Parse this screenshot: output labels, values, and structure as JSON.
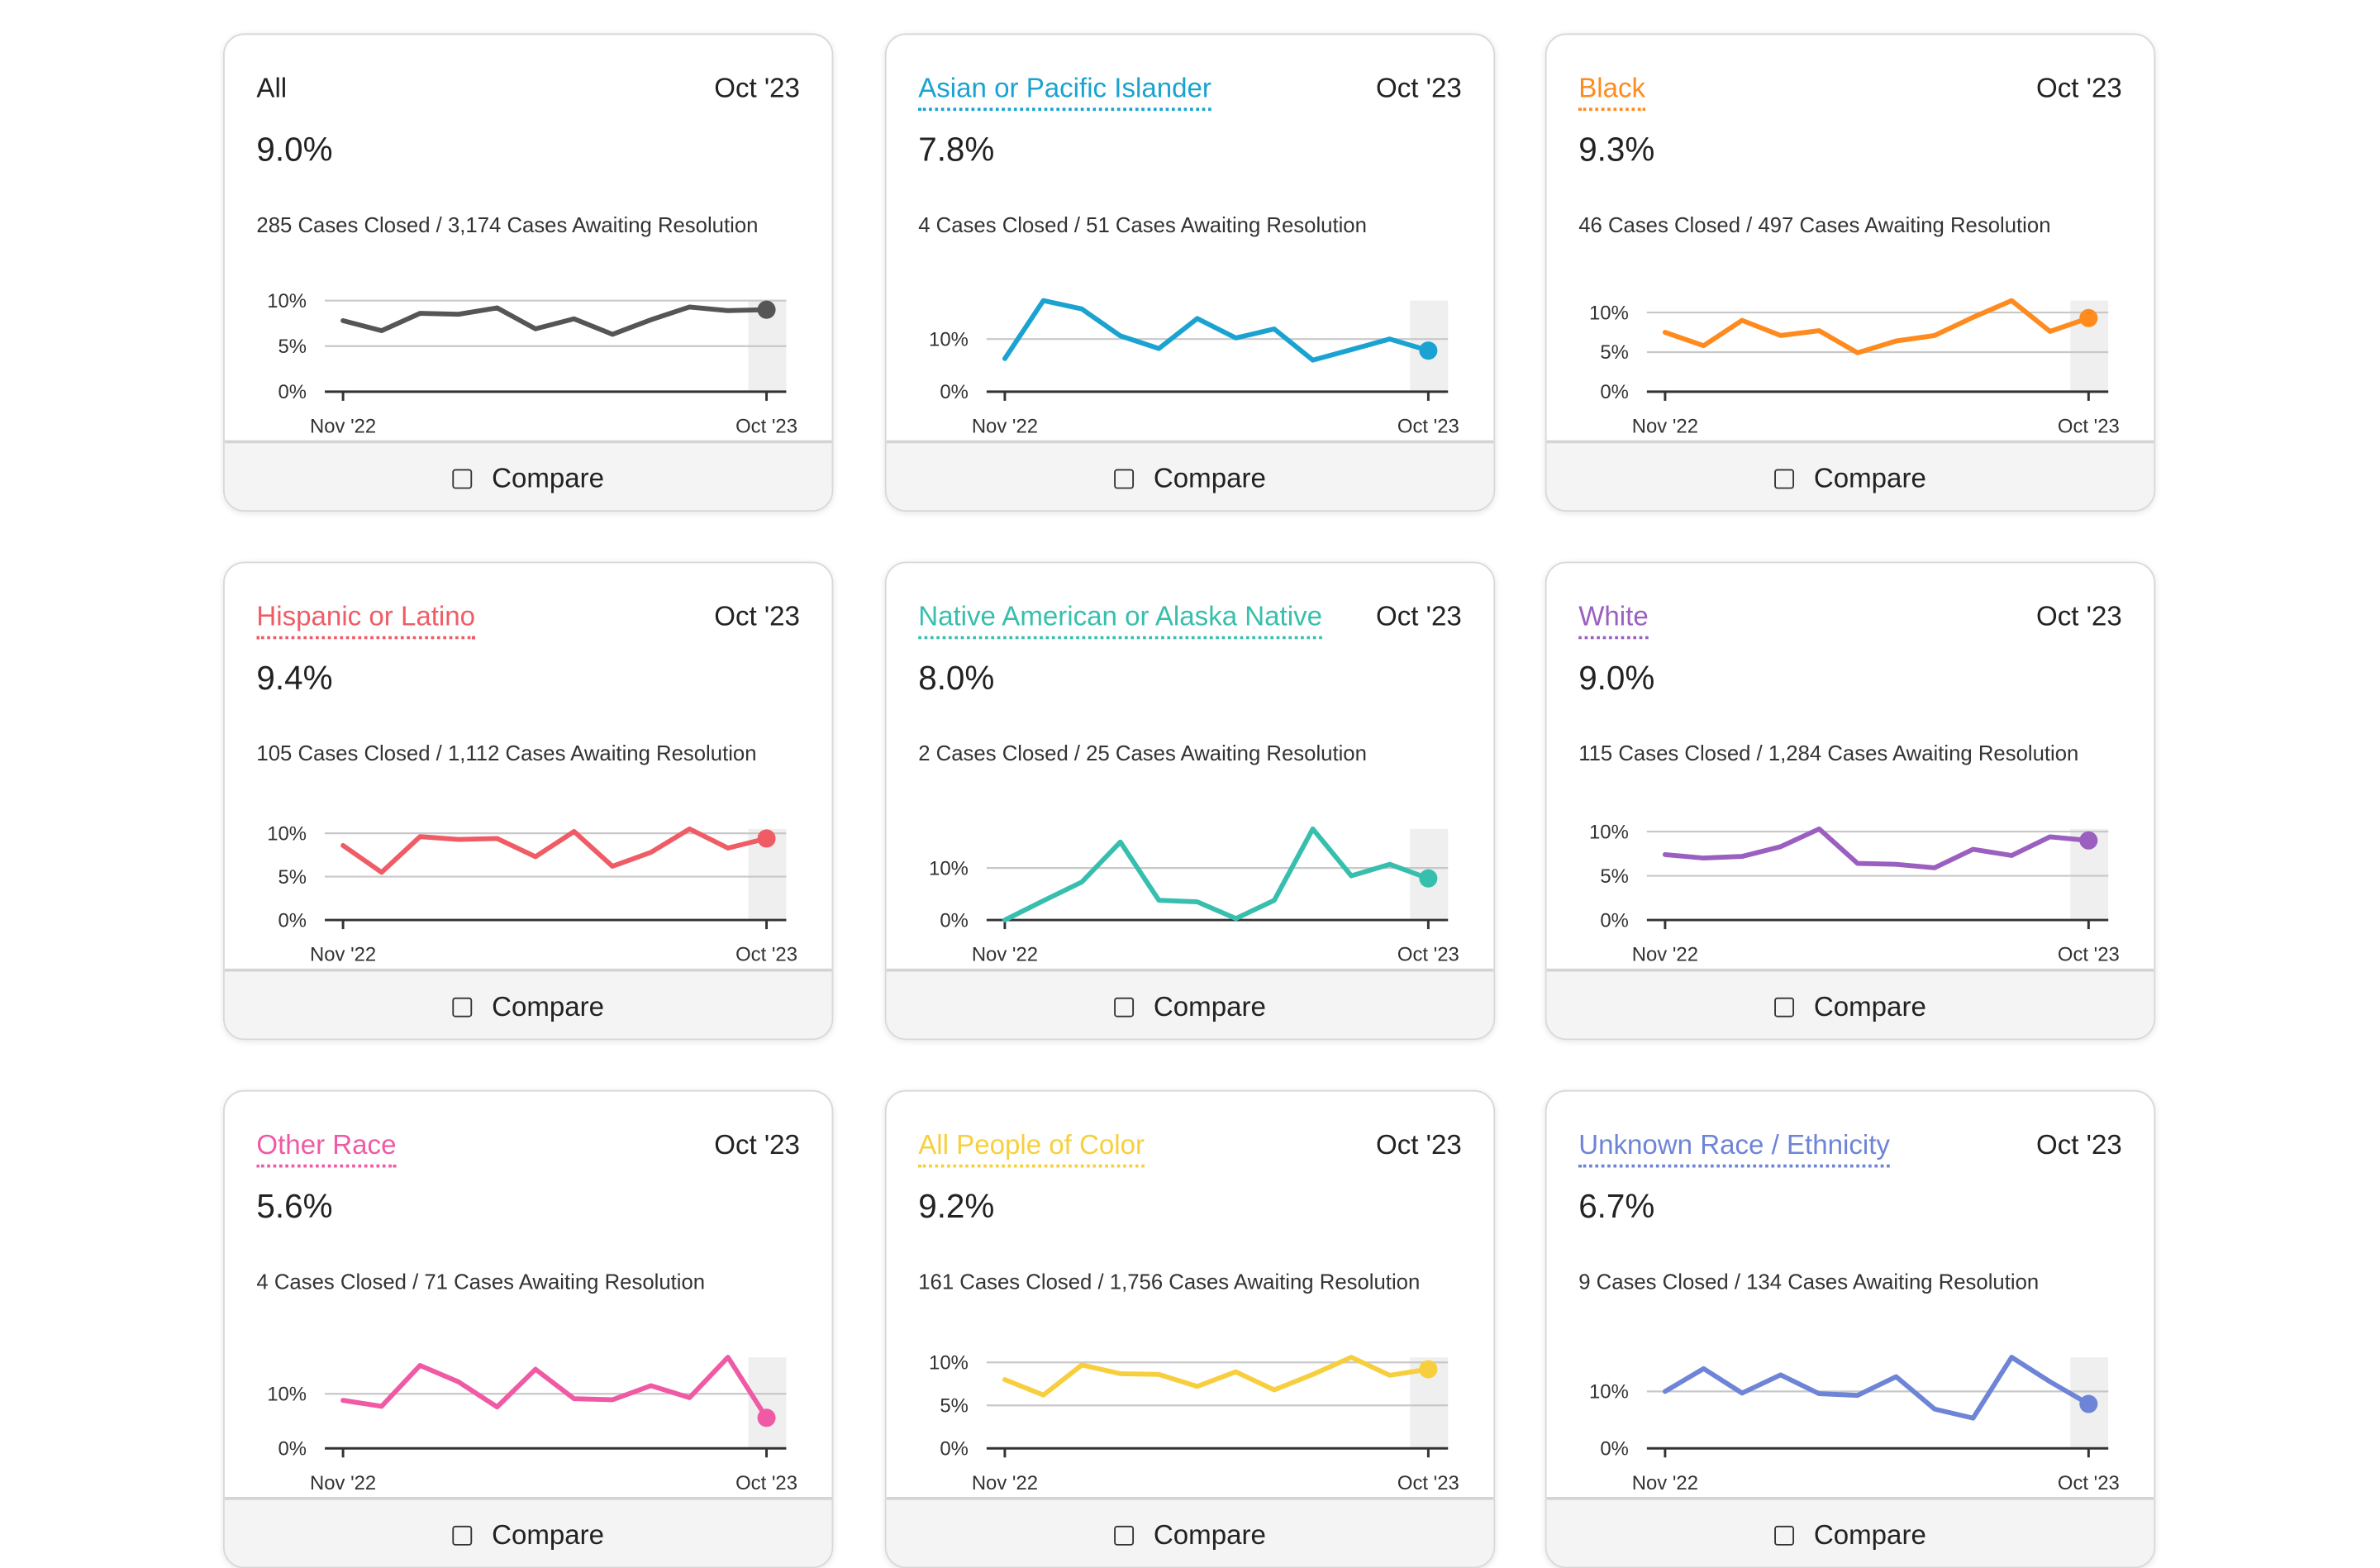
{
  "compare_label": "Compare",
  "axis": {
    "x_start": "Nov '22",
    "x_end": "Oct '23"
  },
  "chart_data": [
    {
      "type": "line",
      "title": "All",
      "date": "Oct '23",
      "value": "9.0%",
      "detail": "285 Cases Closed / 3,174 Cases Awaiting Resolution",
      "color": "#555555",
      "ylim": [
        0,
        10
      ],
      "yticks": [
        "10%",
        "5%",
        "0%"
      ],
      "values": [
        7.8,
        6.7,
        8.6,
        8.5,
        9.2,
        6.9,
        8.0,
        6.3,
        7.9,
        9.3,
        8.9,
        9.0
      ]
    },
    {
      "type": "line",
      "title": "Asian or Pacific Islander",
      "date": "Oct '23",
      "value": "7.8%",
      "detail": "4 Cases Closed / 51 Cases Awaiting Resolution",
      "color": "#1aa3d1",
      "ylim": [
        0,
        10
      ],
      "yticks": [
        "10%",
        "0%"
      ],
      "values": [
        6.3,
        17.3,
        15.7,
        10.6,
        8.2,
        13.9,
        10.2,
        11.9,
        6.0,
        8.0,
        10.0,
        7.8
      ]
    },
    {
      "type": "line",
      "title": "Black",
      "date": "Oct '23",
      "value": "9.3%",
      "detail": "46 Cases Closed / 497 Cases Awaiting Resolution",
      "color": "#ff8a1e",
      "ylim": [
        0,
        10
      ],
      "yticks": [
        "10%",
        "5%",
        "0%"
      ],
      "values": [
        7.5,
        5.8,
        9.0,
        7.1,
        7.7,
        4.9,
        6.4,
        7.1,
        9.4,
        11.5,
        7.6,
        9.3
      ]
    },
    {
      "type": "line",
      "title": "Hispanic or Latino",
      "date": "Oct '23",
      "value": "9.4%",
      "detail": "105 Cases Closed / 1,112 Cases Awaiting Resolution",
      "color": "#ef5c66",
      "ylim": [
        0,
        10
      ],
      "yticks": [
        "10%",
        "5%",
        "0%"
      ],
      "values": [
        8.6,
        5.5,
        9.6,
        9.3,
        9.4,
        7.3,
        10.2,
        6.2,
        7.8,
        10.5,
        8.3,
        9.4
      ]
    },
    {
      "type": "line",
      "title": "Native American or Alaska Native",
      "date": "Oct '23",
      "value": "8.0%",
      "detail": "2 Cases Closed / 25 Cases Awaiting Resolution",
      "color": "#37bfae",
      "ylim": [
        0,
        10
      ],
      "yticks": [
        "10%",
        "0%"
      ],
      "values": [
        0,
        3.7,
        7.3,
        15.0,
        3.8,
        3.5,
        0.3,
        3.8,
        17.5,
        8.5,
        10.7,
        8.0
      ]
    },
    {
      "type": "line",
      "title": "White",
      "date": "Oct '23",
      "value": "9.0%",
      "detail": "115 Cases Closed / 1,284 Cases Awaiting Resolution",
      "color": "#9b5fc0",
      "ylim": [
        0,
        10
      ],
      "yticks": [
        "10%",
        "5%",
        "0%"
      ],
      "values": [
        7.4,
        7.0,
        7.2,
        8.3,
        10.3,
        6.4,
        6.3,
        5.9,
        8.0,
        7.3,
        9.4,
        9.0
      ]
    },
    {
      "type": "line",
      "title": "Other Race",
      "date": "Oct '23",
      "value": "5.6%",
      "detail": "4 Cases Closed / 71 Cases Awaiting Resolution",
      "color": "#f05aa4",
      "ylim": [
        0,
        10
      ],
      "yticks": [
        "10%",
        "0%"
      ],
      "values": [
        8.8,
        7.7,
        15.2,
        12.2,
        7.6,
        14.5,
        9.1,
        8.9,
        11.5,
        9.3,
        16.7,
        5.6
      ]
    },
    {
      "type": "line",
      "title": "All People of Color",
      "date": "Oct '23",
      "value": "9.2%",
      "detail": "161 Cases Closed / 1,756 Cases Awaiting Resolution",
      "color": "#f7cf3e",
      "ylim": [
        0,
        10
      ],
      "yticks": [
        "10%",
        "5%",
        "0%"
      ],
      "values": [
        8.0,
        6.2,
        9.7,
        8.7,
        8.6,
        7.2,
        8.9,
        6.8,
        8.6,
        10.6,
        8.5,
        9.2
      ]
    },
    {
      "type": "line",
      "title": "Unknown Race / Ethnicity",
      "date": "Oct '23",
      "value": "6.7%",
      "detail": "9 Cases Closed / 134 Cases Awaiting Resolution",
      "color": "#6e84d6",
      "ylim": [
        0,
        10
      ],
      "yticks": [
        "10%",
        "0%"
      ],
      "values": [
        10.0,
        14.0,
        9.7,
        12.9,
        9.6,
        9.3,
        12.6,
        6.9,
        5.3,
        16.0,
        11.7,
        7.8
      ]
    }
  ]
}
